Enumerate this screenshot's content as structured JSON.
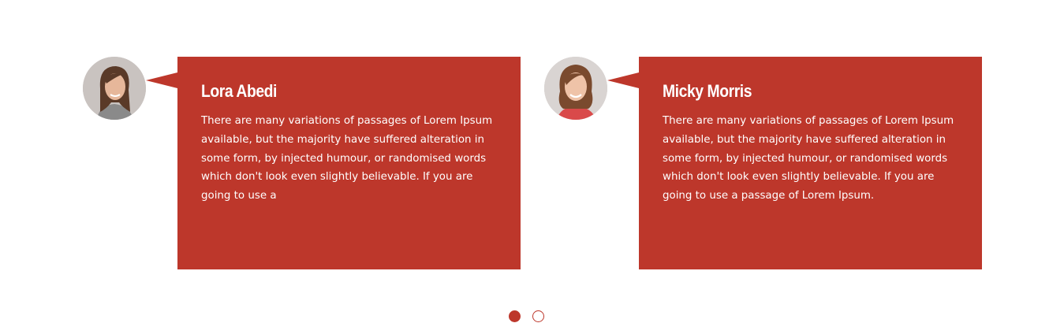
{
  "testimonials": [
    {
      "name": "Lora Abedi",
      "text": "There are many variations of passages of Lorem Ipsum available, but the majority have suffered alteration in some form, by injected humour, or randomised words which don't look even slightly believable. If you are going to use a"
    },
    {
      "name": "Micky Morris",
      "text": "There are many variations of passages of Lorem Ipsum available, but the majority have suffered alteration in some form, by injected humour, or randomised words which don't look even slightly believable. If you are going to use a passage of Lorem Ipsum."
    }
  ],
  "pagination": {
    "active_index": 0,
    "count": 2
  },
  "colors": {
    "accent": "#bd372b",
    "text_on_accent": "#ffffff"
  }
}
